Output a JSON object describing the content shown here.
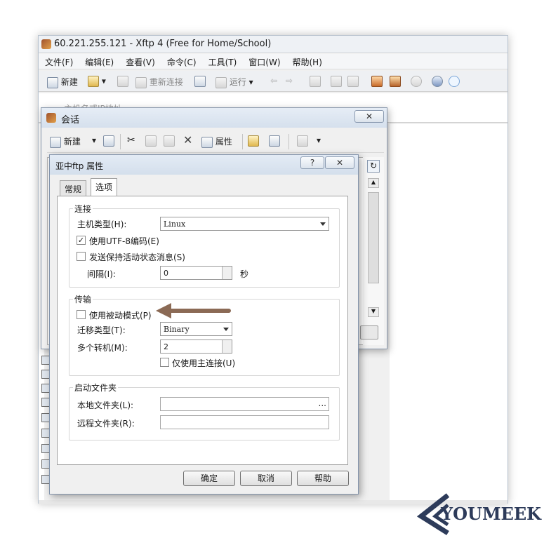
{
  "main_window": {
    "title": "60.221.255.121 - Xftp 4 (Free for Home/School)",
    "menu": [
      "文件(F)",
      "编辑(E)",
      "查看(V)",
      "命令(C)",
      "工具(T)",
      "窗口(W)",
      "帮助(H)"
    ],
    "toolbar": {
      "new_label": "新建",
      "reconnect_label": "重新连接",
      "run_label": "运行"
    },
    "address_placeholder": "主机名或IP地址"
  },
  "session_dialog": {
    "title": "会话",
    "close_label": "✕",
    "toolbar": {
      "new_label": "新建",
      "properties_label": "属性"
    }
  },
  "props_dialog": {
    "title": "亚中ftp 属性",
    "help_label": "?",
    "close_label": "✕",
    "tabs": [
      "常规",
      "选项"
    ],
    "active_tab": "选项",
    "connection": {
      "group_label": "连接",
      "host_type_label": "主机类型(H):",
      "host_type_value": "Linux",
      "use_utf8_label": "使用UTF-8编码(E)",
      "use_utf8_checked": true,
      "keepalive_label": "发送保持活动状态消息(S)",
      "keepalive_checked": false,
      "interval_label": "间隔(I):",
      "interval_value": "0",
      "interval_unit": "秒"
    },
    "transfer": {
      "group_label": "传输",
      "passive_label": "使用被动模式(P)",
      "passive_checked": false,
      "migrate_type_label": "迁移类型(T):",
      "migrate_type_value": "Binary",
      "multi_hop_label": "多个转机(M):",
      "multi_hop_value": "2",
      "main_conn_only_label": "仅使用主连接(U)",
      "main_conn_only_checked": false
    },
    "startup_folder": {
      "group_label": "启动文件夹",
      "local_label": "本地文件夹(L):",
      "local_value": "",
      "browse_label": "...",
      "remote_label": "远程文件夹(R):",
      "remote_value": ""
    },
    "buttons": {
      "ok": "确定",
      "cancel": "取消",
      "help": "帮助"
    }
  },
  "watermark": {
    "text": "YOUMEEK"
  },
  "colors": {
    "arrow": "#8b6a55",
    "logo": "#2d3b5a",
    "title_bar": "#d5e0ed"
  }
}
